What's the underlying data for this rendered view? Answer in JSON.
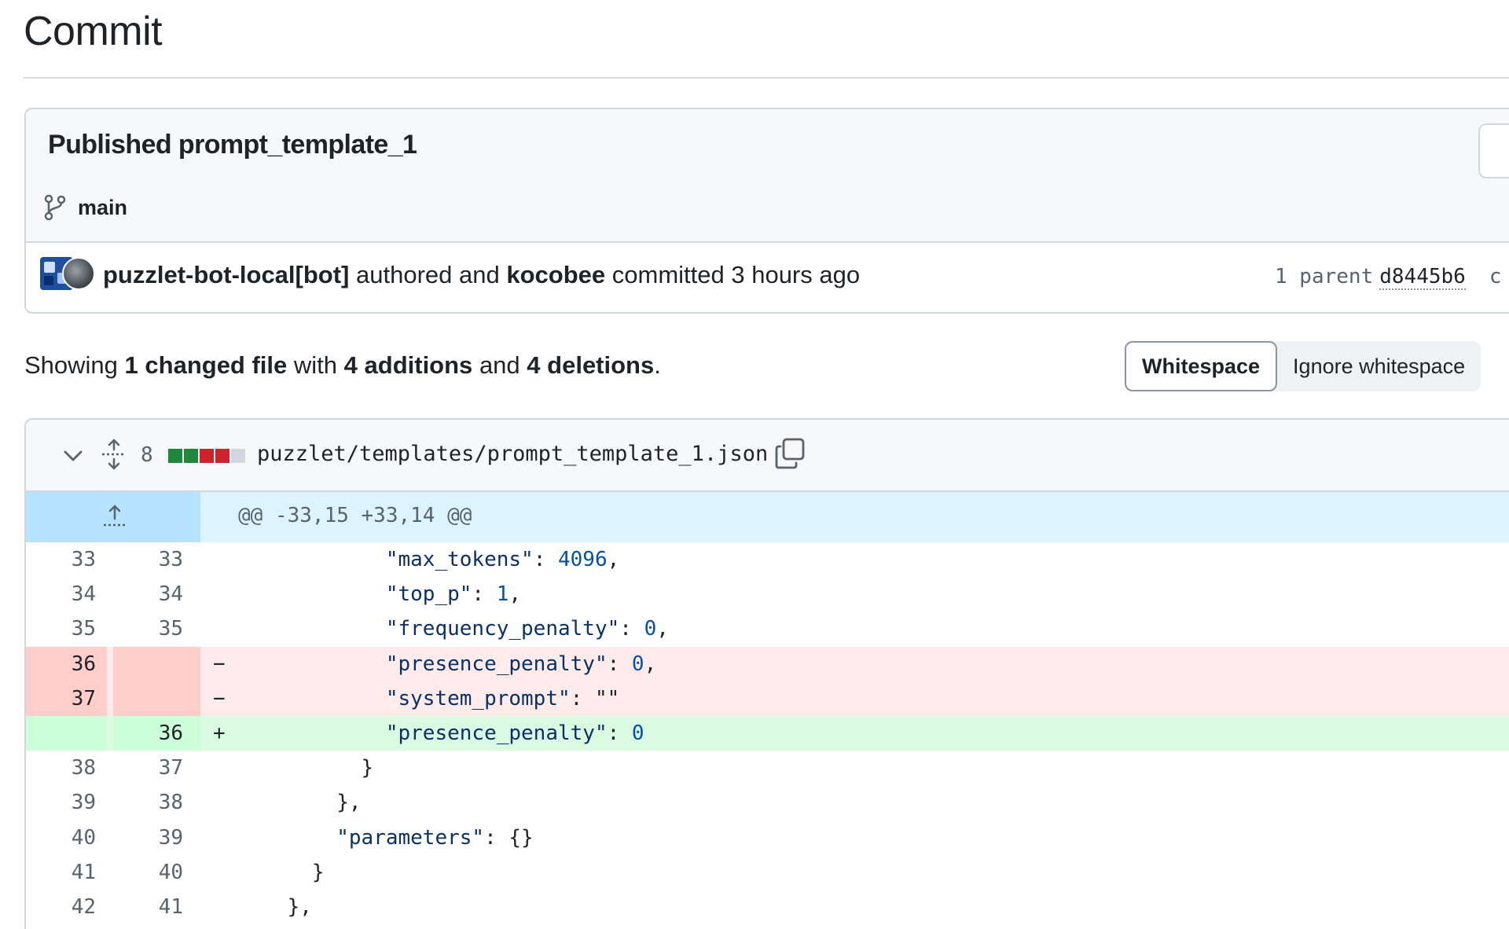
{
  "page": {
    "title": "Commit"
  },
  "commit": {
    "message": "Published prompt_template_1",
    "branch": "main",
    "author": "puzzlet-bot-local[bot]",
    "authored_text": "authored and",
    "committer": "kocobee",
    "committed_text": "committed 3 hours ago",
    "parent_label": "1 parent",
    "parent_sha": "d8445b6",
    "more": "c"
  },
  "summary": {
    "prefix": "Showing",
    "files": "1 changed file",
    "with": "with",
    "additions": "4 additions",
    "and": "and",
    "deletions": "4 deletions",
    "suffix": "."
  },
  "whitespace": {
    "options": [
      "Whitespace",
      "Ignore whitespace"
    ],
    "selected": "Whitespace"
  },
  "file": {
    "change_count": "8",
    "path": "puzzlet/templates/prompt_template_1.json",
    "diffstat": {
      "added": 2,
      "removed": 2,
      "neutral": 1
    },
    "colors": {
      "added": "#1f883d",
      "removed": "#cf222e",
      "neutral": "#d0d7de"
    },
    "hunk_header": "@@ -33,15 +33,14 @@",
    "lines": [
      {
        "type": "context",
        "old": "33",
        "new": "33",
        "sign": "",
        "indent": "            ",
        "key": "\"max_tokens\"",
        "rest": ": ",
        "value": "4096",
        "tail": ","
      },
      {
        "type": "context",
        "old": "34",
        "new": "34",
        "sign": "",
        "indent": "            ",
        "key": "\"top_p\"",
        "rest": ": ",
        "value": "1",
        "tail": ","
      },
      {
        "type": "context",
        "old": "35",
        "new": "35",
        "sign": "",
        "indent": "            ",
        "key": "\"frequency_penalty\"",
        "rest": ": ",
        "value": "0",
        "tail": ","
      },
      {
        "type": "del",
        "old": "36",
        "new": "",
        "sign": "−",
        "indent": "            ",
        "key": "\"presence_penalty\"",
        "rest": ": ",
        "value": "0",
        "tail": ","
      },
      {
        "type": "del",
        "old": "37",
        "new": "",
        "sign": "−",
        "indent": "            ",
        "key": "\"system_prompt\"",
        "rest": ": \"\"",
        "value": "",
        "tail": ""
      },
      {
        "type": "add",
        "old": "",
        "new": "36",
        "sign": "+",
        "indent": "            ",
        "key": "\"presence_penalty\"",
        "rest": ": ",
        "value": "0",
        "tail": ""
      },
      {
        "type": "context",
        "old": "38",
        "new": "37",
        "sign": "",
        "indent": "          ",
        "key": "",
        "rest": "}",
        "value": "",
        "tail": ""
      },
      {
        "type": "context",
        "old": "39",
        "new": "38",
        "sign": "",
        "indent": "        ",
        "key": "",
        "rest": "},",
        "value": "",
        "tail": ""
      },
      {
        "type": "context",
        "old": "40",
        "new": "39",
        "sign": "",
        "indent": "        ",
        "key": "\"parameters\"",
        "rest": ": {}",
        "value": "",
        "tail": ""
      },
      {
        "type": "context",
        "old": "41",
        "new": "40",
        "sign": "",
        "indent": "      ",
        "key": "",
        "rest": "}",
        "value": "",
        "tail": ""
      },
      {
        "type": "context",
        "old": "42",
        "new": "41",
        "sign": "",
        "indent": "    ",
        "key": "",
        "rest": "},",
        "value": "",
        "tail": ""
      }
    ]
  },
  "icons": {
    "branch": "git-branch-icon",
    "chevron": "chevron-down-icon",
    "expand": "unfold-icon",
    "copy": "copy-icon",
    "hunk_expand": "expand-up-icon"
  }
}
